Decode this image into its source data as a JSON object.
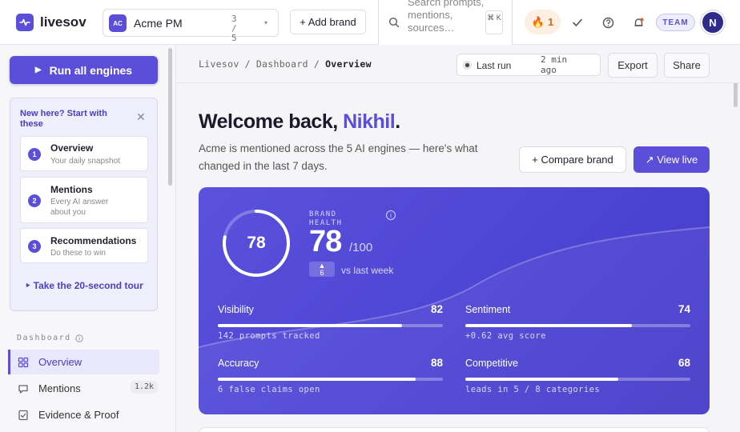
{
  "app": {
    "name": "livesov"
  },
  "brand_selector": {
    "initials": "AC",
    "name": "Acme PM",
    "count": "3 / 5"
  },
  "add_brand": "+ Add brand",
  "search": {
    "placeholder": "Search prompts, mentions, sources…",
    "shortcut": "⌘ K"
  },
  "streak": {
    "count": "1"
  },
  "team_badge": "TEAM",
  "user": {
    "initial": "N"
  },
  "sidebar": {
    "run_button": "Run all engines",
    "onboarding": {
      "title": "New here? Start with these",
      "steps": [
        {
          "num": "1",
          "title": "Overview",
          "subtitle": "Your daily snapshot"
        },
        {
          "num": "2",
          "title": "Mentions",
          "subtitle": "Every AI answer about you"
        },
        {
          "num": "3",
          "title": "Recommendations",
          "subtitle": "Do these to win"
        }
      ],
      "tour_link": "‣ Take the 20-second tour"
    },
    "section_label": "Dashboard",
    "nav": [
      {
        "label": "Overview",
        "icon": "grid-icon",
        "active": true
      },
      {
        "label": "Mentions",
        "icon": "chat-icon",
        "badge": "1.2k"
      },
      {
        "label": "Evidence & Proof",
        "icon": "check-doc-icon"
      }
    ]
  },
  "breadcrumb": {
    "root": "Livesov",
    "parent": "Dashboard",
    "current": "Overview",
    "sep": "/"
  },
  "last_run": {
    "label": "Last run",
    "value": "2 min ago"
  },
  "header_buttons": {
    "export": "Export",
    "share": "Share"
  },
  "welcome": {
    "prefix": "Welcome back, ",
    "name": "Nikhil",
    "suffix": "."
  },
  "intro": "Acme is mentioned across the 5 AI engines — here's what changed in the last 7 days.",
  "actions": {
    "compare": "+ Compare brand",
    "view_live": "↗ View live"
  },
  "health": {
    "score": 78,
    "ring_label": "78",
    "label": "BRAND HEALTH",
    "big_value": "78",
    "max": "/100",
    "delta": "▲\n6",
    "delta_label": "vs last week",
    "metrics": [
      {
        "name": "Visibility",
        "value": "82",
        "level": 0.82,
        "sub": "142 prompts tracked"
      },
      {
        "name": "Sentiment",
        "value": "74",
        "level": 0.74,
        "sub": "+0.62 avg score"
      },
      {
        "name": "Accuracy",
        "value": "88",
        "level": 0.88,
        "sub": "6 false claims open"
      },
      {
        "name": "Competitive",
        "value": "68",
        "level": 0.68,
        "sub": "leads in 5 / 8 categories"
      }
    ]
  },
  "colors": {
    "accent": "#5b4fd9",
    "card": "#4d45d4",
    "streak": "#d2691e"
  }
}
